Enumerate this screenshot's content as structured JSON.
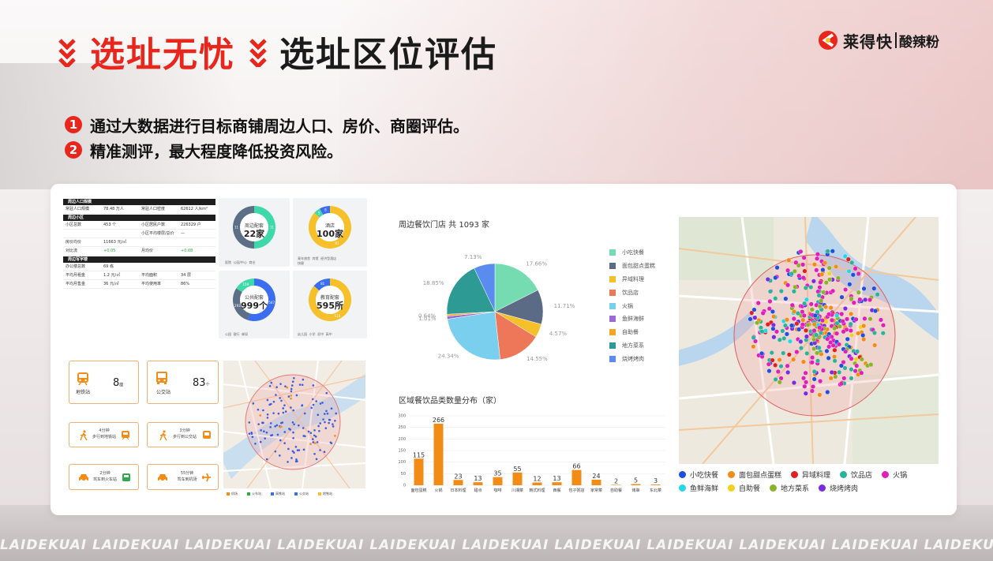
{
  "header": {
    "title_red": "选址无忧",
    "title_black": "选址区位评估"
  },
  "logo": {
    "brand": "莱得快",
    "sub": "酸辣粉"
  },
  "bullets": [
    {
      "num": "1",
      "text": "通过大数据进行目标商铺周边人口、房价、商圈评估。"
    },
    {
      "num": "2",
      "text": "精准测评，最大程度降低投资风险。"
    }
  ],
  "population_table": {
    "section1": "周边人口规模",
    "row1": [
      "常驻人口规模",
      "78.48 万人",
      "常驻人口密度",
      "62612 人/km²"
    ],
    "section2": "周边小区",
    "row2a": [
      "小区总数",
      "453 个",
      "小区居民户数",
      "226329 户"
    ],
    "row2b": [
      "",
      "",
      "小区平均楼层/总价",
      "—"
    ],
    "row2c": [
      "房价均价",
      "11663 元/㎡",
      "",
      ""
    ],
    "row2d": [
      "对比流",
      "+0.05",
      "月均价",
      "+0.08"
    ],
    "section3": "周边写字楼",
    "row3a": [
      "办公楼总数",
      "69 栋",
      "",
      ""
    ],
    "row3b": [
      "平均月租金",
      "1.2 元/㎡",
      "平均面积",
      "34 层"
    ],
    "row3c": [
      "平均月售金",
      "36 元/㎡",
      "平均使用率",
      "86%"
    ]
  },
  "donuts": [
    {
      "label": "周边配套",
      "value": "22家",
      "legend": [
        "医院",
        "公园/中心",
        "商业"
      ]
    },
    {
      "label": "酒店",
      "value": "100家",
      "legend": [
        "青年旅舍",
        "宾馆",
        "经济型酒店",
        "快捷"
      ]
    },
    {
      "label": "公共配套",
      "value": "999个",
      "legend": [
        "公园",
        "银行",
        "邮局"
      ]
    },
    {
      "label": "教育配套",
      "value": "595所",
      "legend": [
        "幼儿园",
        "小学",
        "初中",
        "高中"
      ]
    }
  ],
  "transport": {
    "metro_label": "地铁站",
    "metro_count": "8",
    "metro_unit": "座",
    "bus_label": "公交站",
    "bus_count": "83",
    "bus_unit": "个",
    "walk_metro_time": "4分钟",
    "walk_metro_desc": "步行到地铁站",
    "walk_bus_time": "3分钟",
    "walk_bus_desc": "步行到公交站",
    "drive_train_time": "2分钟",
    "drive_train_desc": "驾车到火车站",
    "drive_airport_time": "55分钟",
    "drive_airport_desc": "驾车到机场",
    "map_legend": [
      "机场",
      "火车站",
      "高铁站",
      "公交站",
      "地铁站"
    ]
  },
  "pie": {
    "title": "周边餐饮门店 共 1093 家",
    "labels_pct": [
      "17.66%",
      "11.71%",
      "4.57%",
      "14.55%",
      "24.34%",
      "1.01%",
      "0.64%",
      "18.85%",
      "7.13%"
    ]
  },
  "bar": {
    "title": "区域餐饮品类数量分布（家）"
  },
  "map2_legend": [
    [
      "小吃快餐",
      "面包甜点蛋糕",
      "异域料理",
      "饮品店",
      "火锅"
    ],
    [
      "鱼鲜海鲜",
      "自助餐",
      "地方菜系",
      "烧烤烤肉"
    ]
  ],
  "colors": {
    "brand_red": "#e8261c",
    "orange": "#f28c16",
    "teal": "#3fd8a8",
    "slate": "#5c6f86"
  },
  "watermark": "LAIDEKUAI",
  "chart_data": [
    {
      "type": "pie",
      "title": "周边餐饮门店 共 1093 家",
      "categories": [
        "小吃快餐",
        "面包甜点蛋糕",
        "异域料理",
        "饮品店",
        "火锅",
        "鱼鲜海鲜",
        "自助餐",
        "地方菜系",
        "烧烤烤肉"
      ],
      "values": [
        17.66,
        11.71,
        4.57,
        14.55,
        24.34,
        1.01,
        0.64,
        18.85,
        7.13
      ],
      "colors": [
        "#74dcb0",
        "#5b6b86",
        "#f6c02a",
        "#ee7759",
        "#7bcfee",
        "#9d6bd7",
        "#f5a623",
        "#2e9a94",
        "#5a8cf0"
      ]
    },
    {
      "type": "bar",
      "title": "区域餐饮品类数量分布（家）",
      "categories": [
        "面包蛋糕",
        "火锅",
        "日本料理",
        "甜点",
        "咖啡",
        "川湘菜",
        "韩式料理",
        "西餐",
        "包子粥店",
        "家常菜",
        "自助餐",
        "烤串",
        "东北菜"
      ],
      "values": [
        115,
        266,
        23,
        13,
        35,
        55,
        12,
        13,
        66,
        24,
        2,
        5,
        3
      ],
      "ylim": [
        0,
        300
      ],
      "yticks": [
        0,
        50,
        100,
        150,
        200,
        250,
        300
      ],
      "color": "#f28c16"
    },
    {
      "type": "pie",
      "title": "周边配套",
      "center_label": "22家",
      "values": [
        11,
        11
      ],
      "slice_labels": [
        "11",
        "11"
      ],
      "colors": [
        "#3fd8a8",
        "#5c6f86"
      ]
    },
    {
      "type": "pie",
      "title": "酒店",
      "center_label": "100家",
      "values": [
        87,
        5,
        8
      ],
      "slice_labels": [
        "87",
        "5",
        "8"
      ],
      "colors": [
        "#f6c02a",
        "#3fd8a8",
        "#3a6df0"
      ]
    },
    {
      "type": "pie",
      "title": "公共配套",
      "center_label": "999个",
      "values": [
        547,
        293,
        159
      ],
      "slice_labels": [
        "547",
        "293",
        "159"
      ],
      "colors": [
        "#3a6df0",
        "#5c6f86",
        "#3fd8a8"
      ]
    },
    {
      "type": "pie",
      "title": "教育配套",
      "center_label": "595所",
      "values": [
        514,
        81
      ],
      "slice_labels": [
        "514",
        "81"
      ],
      "colors": [
        "#f6c02a",
        "#3a6df0"
      ]
    }
  ]
}
